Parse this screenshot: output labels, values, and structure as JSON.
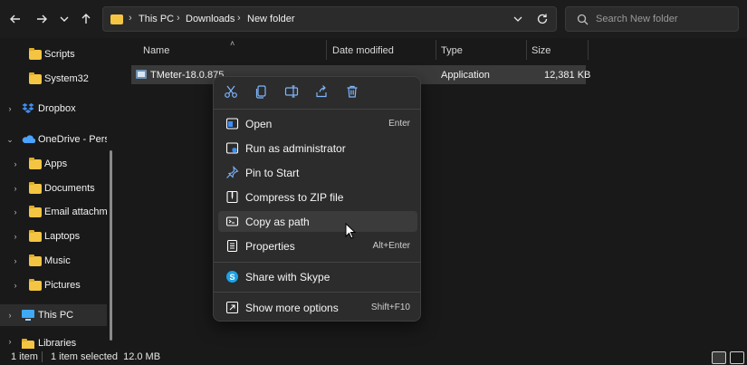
{
  "nav": {
    "back_icon": "arrow-left-icon",
    "forward_icon": "arrow-right-icon",
    "recent_icon": "chevron-down-icon",
    "up_icon": "arrow-up-icon",
    "breadcrumb": [
      "This PC",
      "Downloads",
      "New folder"
    ],
    "search_placeholder": "Search New folder"
  },
  "sidebar": {
    "items": [
      {
        "label": "Scripts",
        "icon": "folder-icon"
      },
      {
        "label": "System32",
        "icon": "folder-icon"
      },
      {
        "label": "Dropbox",
        "icon": "dropbox-icon"
      },
      {
        "label": "OneDrive - Perso",
        "icon": "onedrive-icon"
      },
      {
        "label": "Apps",
        "icon": "folder-icon"
      },
      {
        "label": "Documents",
        "icon": "folder-icon"
      },
      {
        "label": "Email attachme",
        "icon": "folder-icon"
      },
      {
        "label": "Laptops",
        "icon": "folder-icon"
      },
      {
        "label": "Music",
        "icon": "folder-icon"
      },
      {
        "label": "Pictures",
        "icon": "folder-icon"
      },
      {
        "label": "This PC",
        "icon": "computer-icon"
      },
      {
        "label": "Libraries",
        "icon": "library-icon"
      }
    ]
  },
  "columns": {
    "name": "Name",
    "date": "Date modified",
    "type": "Type",
    "size": "Size"
  },
  "file": {
    "name": "TMeter-18.0.875",
    "type": "Application",
    "size": "12,381 KB"
  },
  "context_menu": {
    "quick_actions": [
      "cut-icon",
      "copy-icon",
      "rename-icon",
      "share-icon",
      "delete-icon"
    ],
    "items": [
      {
        "label": "Open",
        "shortcut": "Enter",
        "icon": "open-icon"
      },
      {
        "label": "Run as administrator",
        "shortcut": "",
        "icon": "shield-icon"
      },
      {
        "label": "Pin to Start",
        "shortcut": "",
        "icon": "pin-icon"
      },
      {
        "label": "Compress to ZIP file",
        "shortcut": "",
        "icon": "zip-icon"
      },
      {
        "label": "Copy as path",
        "shortcut": "",
        "icon": "copy-path-icon"
      },
      {
        "label": "Properties",
        "shortcut": "Alt+Enter",
        "icon": "properties-icon"
      },
      {
        "label": "Share with Skype",
        "shortcut": "",
        "icon": "skype-icon"
      },
      {
        "label": "Show more options",
        "shortcut": "Shift+F10",
        "icon": "more-options-icon"
      }
    ]
  },
  "status": {
    "count": "1 item",
    "selected": "1 item selected  12.0 MB"
  },
  "colors": {
    "background": "#191919",
    "menu": "#2c2c2c",
    "hover": "#3b3b3b",
    "folder": "#f4c542",
    "accent": "#4aa3ff"
  }
}
